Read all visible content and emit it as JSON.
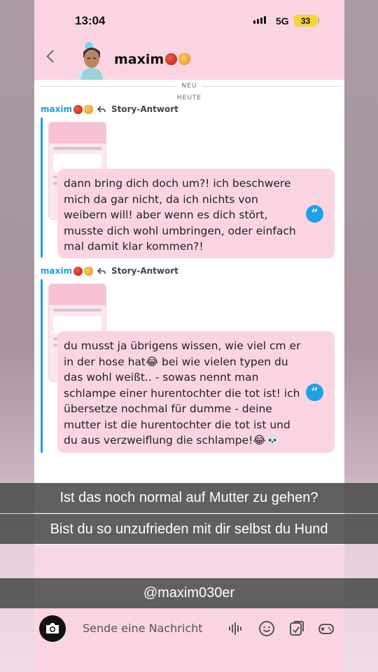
{
  "status_bar": {
    "time": "13:04",
    "network": "5G",
    "battery": "33"
  },
  "header": {
    "contact_name": "maxim"
  },
  "dividers": {
    "new": "NEU",
    "today": "HEUTE"
  },
  "messages": [
    {
      "sender": "maxim",
      "label": "Story-Antwort",
      "text": "dann bring dich doch um?! ich beschwere mich da gar nicht, da ich nichts von weibern will! aber wenn es dich stört, musste dich wohl umbringen, oder einfach mal damit klar kommen?!"
    },
    {
      "sender": "maxim",
      "label": "Story-Antwort",
      "text": "du musst ja übrigens wissen, wie viel cm er in der hose hat😂 bei wie vielen typen du das wohl weißt.. - sowas nennt man schlampe einer hurentochter die tot ist! ich übersetze nochmal für dumme - deine mutter ist die hurentochter die tot ist und du aus verzweiflung die schlampe!😂💀"
    }
  ],
  "captions": [
    "Ist das noch normal auf Mutter zu gehen?",
    "Bist du so unzufrieden mit dir selbst du Hund"
  ],
  "watermark": "@maxim030er",
  "composer": {
    "placeholder": "Sende eine Nachricht"
  },
  "icons": [
    "back-chevron-icon",
    "camera-icon",
    "voice-icon",
    "emoji-icon",
    "sticker-icon",
    "game-icon",
    "quote-icon",
    "reply-arrow-icon"
  ]
}
